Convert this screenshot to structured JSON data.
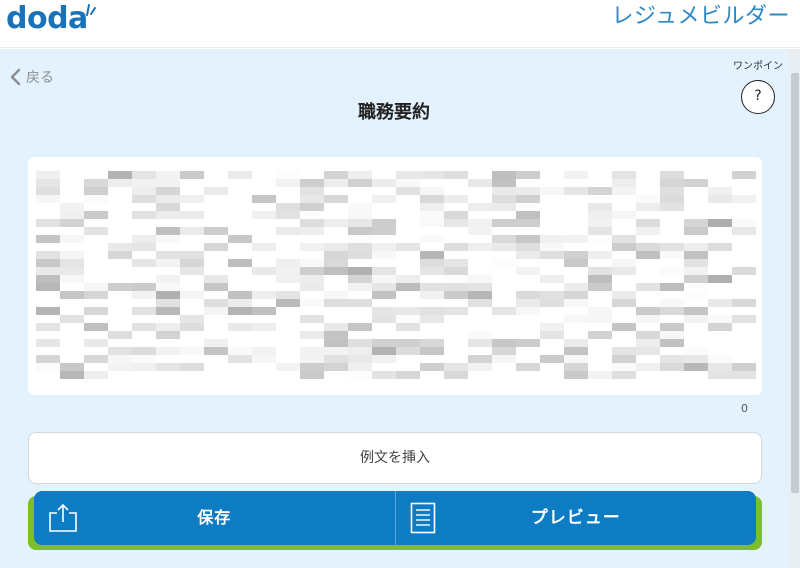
{
  "header": {
    "logo_text": "doda",
    "app_title": "レジュメビルダー",
    "brand_color": "#1a73b8"
  },
  "nav": {
    "back_label": "戻る",
    "back_icon": "chevron-left-icon"
  },
  "hint": {
    "label": "ワンポイン",
    "symbol": "?"
  },
  "page": {
    "title": "職務要約"
  },
  "editor": {
    "char_count": "0"
  },
  "actions": {
    "insert_example_label": "例文を挿入",
    "save_label": "保存",
    "save_icon": "share-upload-icon",
    "preview_label": "プレビュー",
    "preview_icon": "document-icon",
    "primary_color": "#0e7cc3",
    "highlight_color": "#7cbf2a"
  }
}
